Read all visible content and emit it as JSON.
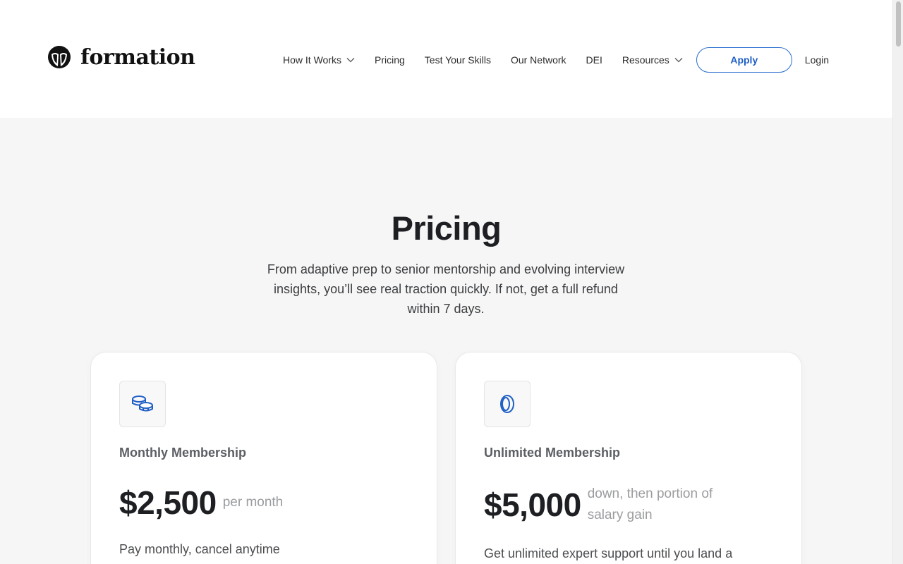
{
  "brand": {
    "name": "formation",
    "logo_icon": "formation-logo-icon"
  },
  "nav": {
    "items": [
      {
        "label": "How It Works",
        "has_dropdown": true
      },
      {
        "label": "Pricing",
        "has_dropdown": false
      },
      {
        "label": "Test Your Skills",
        "has_dropdown": false
      },
      {
        "label": "Our Network",
        "has_dropdown": false
      },
      {
        "label": "DEI",
        "has_dropdown": false
      },
      {
        "label": "Resources",
        "has_dropdown": true
      }
    ],
    "apply_label": "Apply",
    "login_label": "Login"
  },
  "hero": {
    "title": "Pricing",
    "subtitle": "From adaptive prep to senior mentorship and evolving interview insights, you’ll see real traction quickly. If not, get a full refund within 7 days."
  },
  "plans": [
    {
      "icon": "coins-stack-icon",
      "title": "Monthly Membership",
      "price": "$2,500",
      "price_note": "per month",
      "description": "Pay monthly, cancel anytime"
    },
    {
      "icon": "coin-icon",
      "title": "Unlimited Membership",
      "price": "$5,000",
      "price_note": "down, then portion of salary gain",
      "description": "Get unlimited expert support until you land a"
    }
  ],
  "colors": {
    "accent": "#1f5fc5",
    "background": "#f6f6f6",
    "card": "#ffffff"
  }
}
